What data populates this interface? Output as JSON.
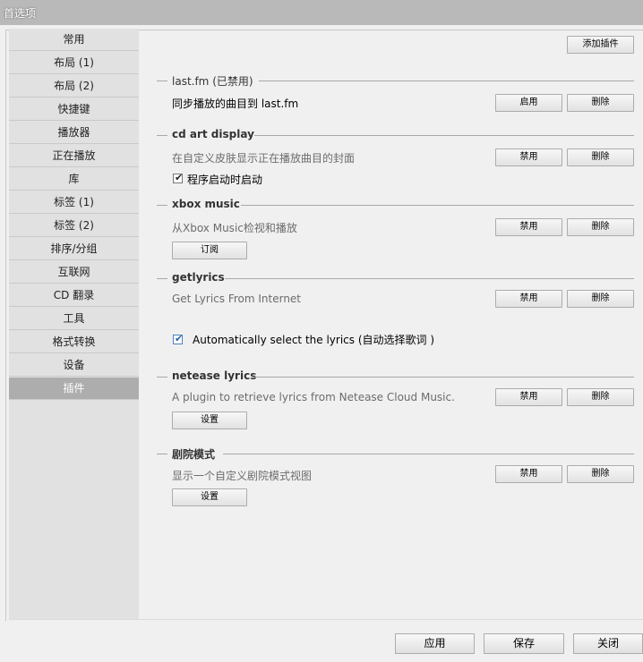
{
  "window": {
    "title": "首选项"
  },
  "sidebar": {
    "items": [
      {
        "label": "常用"
      },
      {
        "label": "布局 (1)"
      },
      {
        "label": "布局 (2)"
      },
      {
        "label": "快捷键"
      },
      {
        "label": "播放器"
      },
      {
        "label": "正在播放"
      },
      {
        "label": "库"
      },
      {
        "label": "标签 (1)"
      },
      {
        "label": "标签 (2)"
      },
      {
        "label": "排序/分组"
      },
      {
        "label": "互联网"
      },
      {
        "label": "CD 翻录"
      },
      {
        "label": "工具"
      },
      {
        "label": "格式转换"
      },
      {
        "label": "设备"
      },
      {
        "label": "插件"
      }
    ],
    "selected": "插件"
  },
  "plugins": {
    "add_button": "添加插件",
    "list": [
      {
        "name": "last.fm (已禁用)",
        "desc": "同步播放的曲目到 last.fm",
        "toggle": "启用",
        "delete": "删除"
      },
      {
        "name": "cd art display",
        "desc": "在自定义皮肤显示正在播放曲目的封面",
        "toggle": "禁用",
        "delete": "删除",
        "checkbox": "程序启动时启动",
        "checked": true
      },
      {
        "name": "xbox music",
        "desc": "从Xbox Music检视和播放",
        "toggle": "禁用",
        "delete": "删除",
        "extra_button": "订阅"
      },
      {
        "name": "getlyrics",
        "desc": "Get Lyrics From Internet",
        "toggle": "禁用",
        "delete": "删除",
        "checkbox": "Automatically select the lyrics (自动选择歌词 )",
        "checked": true
      },
      {
        "name": "netease lyrics",
        "desc": "A plugin to retrieve lyrics from Netease Cloud Music.",
        "toggle": "禁用",
        "delete": "删除",
        "extra_button": "设置"
      },
      {
        "name": "剧院模式",
        "desc": "显示一个自定义剧院模式视图",
        "toggle": "禁用",
        "delete": "删除",
        "extra_button": "设置"
      }
    ]
  },
  "footer": {
    "apply": "应用",
    "save": "保存",
    "close": "关闭"
  }
}
